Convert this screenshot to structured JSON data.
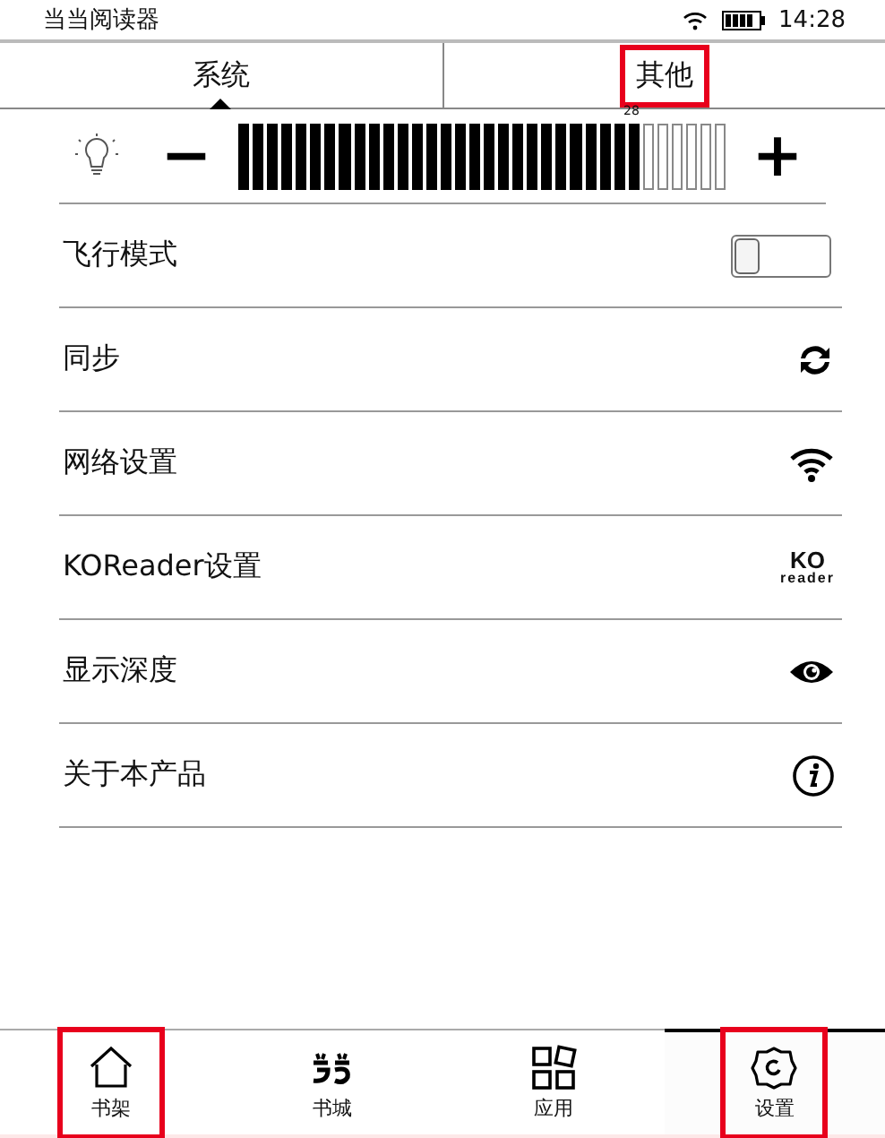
{
  "status_bar": {
    "title": "当当阅读器",
    "time": "14:28"
  },
  "tabs": [
    {
      "label": "系统",
      "selected": true,
      "highlighted": false
    },
    {
      "label": "其他",
      "selected": false,
      "highlighted": true
    }
  ],
  "brightness": {
    "reading": "28",
    "minus": "−",
    "plus": "+"
  },
  "settings": [
    {
      "label": "飞行模式",
      "kind": "toggle",
      "on": false
    },
    {
      "label": "同步",
      "kind": "sync"
    },
    {
      "label": "网络设置",
      "kind": "wifi"
    },
    {
      "label": "KOReader设置",
      "kind": "logo",
      "logo_lines": [
        "KO",
        "reader"
      ]
    },
    {
      "label": "显示深度",
      "kind": "eye"
    },
    {
      "label": "关于本产品",
      "kind": "info"
    }
  ],
  "nav": [
    {
      "label": "书架",
      "kind": "home",
      "selected": false,
      "highlighted": true
    },
    {
      "label": "书城",
      "kind": "store",
      "selected": false,
      "highlighted": false
    },
    {
      "label": "应用",
      "kind": "apps",
      "selected": false,
      "highlighted": false
    },
    {
      "label": "设置",
      "kind": "settings",
      "selected": true,
      "highlighted": true
    }
  ]
}
